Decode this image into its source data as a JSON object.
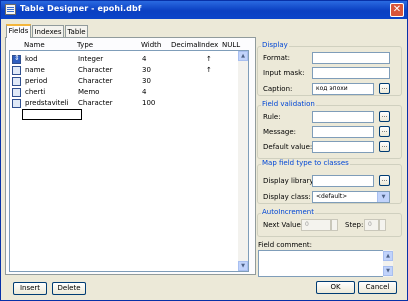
{
  "window": {
    "title": "Table Designer - epohi.dbf",
    "close_glyph": "✕"
  },
  "tabs": [
    {
      "label": "Fields",
      "active": true
    },
    {
      "label": "Indexes",
      "active": false
    },
    {
      "label": "Table",
      "active": false
    }
  ],
  "grid": {
    "columns": [
      "Name",
      "Type",
      "Width",
      "Decimal",
      "Index",
      "NULL"
    ],
    "rows": [
      {
        "name": "kod",
        "type": "Integer",
        "width": "4",
        "decimal": "",
        "index": "↑",
        "null": ""
      },
      {
        "name": "name",
        "type": "Character",
        "width": "30",
        "decimal": "",
        "index": "↑",
        "null": ""
      },
      {
        "name": "period",
        "type": "Character",
        "width": "30",
        "decimal": "",
        "index": "",
        "null": ""
      },
      {
        "name": "cherti",
        "type": "Memo",
        "width": "4",
        "decimal": "",
        "index": "",
        "null": ""
      },
      {
        "name": "predstaviteli",
        "type": "Character",
        "width": "100",
        "decimal": "",
        "index": "",
        "null": ""
      }
    ]
  },
  "buttons": {
    "insert": "Insert",
    "delete": "Delete",
    "ok": "OK",
    "cancel": "Cancel"
  },
  "display": {
    "title": "Display",
    "format_label": "Format:",
    "format_value": "",
    "input_mask_label": "Input mask:",
    "input_mask_value": "",
    "caption_label": "Caption:",
    "caption_value": "код эпохи"
  },
  "validation": {
    "title": "Field validation",
    "rule_label": "Rule:",
    "message_label": "Message:",
    "default_label": "Default value:"
  },
  "map_field": {
    "title": "Map field type to classes",
    "library_label": "Display library:",
    "class_label": "Display class:",
    "class_value": "<default>"
  },
  "autoincrement": {
    "title": "AutoIncrement",
    "next_label": "Next Value:",
    "next_value": "0",
    "step_label": "Step:",
    "step_value": "0"
  },
  "comment": {
    "label": "Field comment:"
  },
  "icons": {
    "ellipsis": "...",
    "up": "▲",
    "down": "▼"
  }
}
